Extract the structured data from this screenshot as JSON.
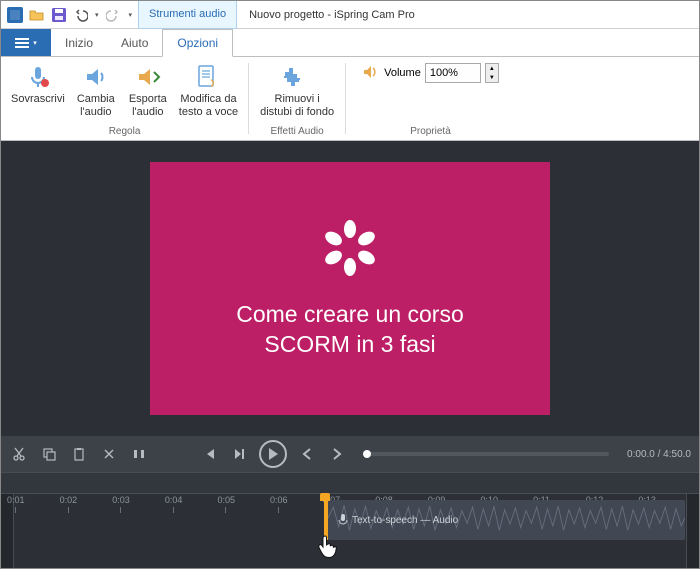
{
  "titlebar": {
    "context_tab": "Strumenti audio",
    "title": "Nuovo progetto - iSpring Cam Pro"
  },
  "tabs": {
    "home": "Inizio",
    "help": "Aiuto",
    "options": "Opzioni"
  },
  "ribbon": {
    "overwrite": "Sovrascrivi",
    "change_audio_l1": "Cambia",
    "change_audio_l2": "l'audio",
    "export_audio_l1": "Esporta",
    "export_audio_l2": "l'audio",
    "tts_l1": "Modifica da",
    "tts_l2": "testo a voce",
    "group_adjust": "Regola",
    "denoise_l1": "Rimuovi i",
    "denoise_l2": "distubi di fondo",
    "group_effects": "Effetti Audio",
    "volume_label": "Volume",
    "volume_value": "100%",
    "group_properties": "Proprietà"
  },
  "slide": {
    "line1": "Come creare un corso",
    "line2": "SCORM in 3 fasi"
  },
  "player": {
    "time": "0:00.0 / 4:50.0"
  },
  "timeline": {
    "ticks": [
      "0:01",
      "0:02",
      "0:03",
      "0:04",
      "0:05",
      "0:06",
      "0:07",
      "0:08",
      "0:09",
      "0:10",
      "0:11",
      "0:12",
      "0:13"
    ],
    "clip_label": "Text-to-speech — Audio"
  }
}
